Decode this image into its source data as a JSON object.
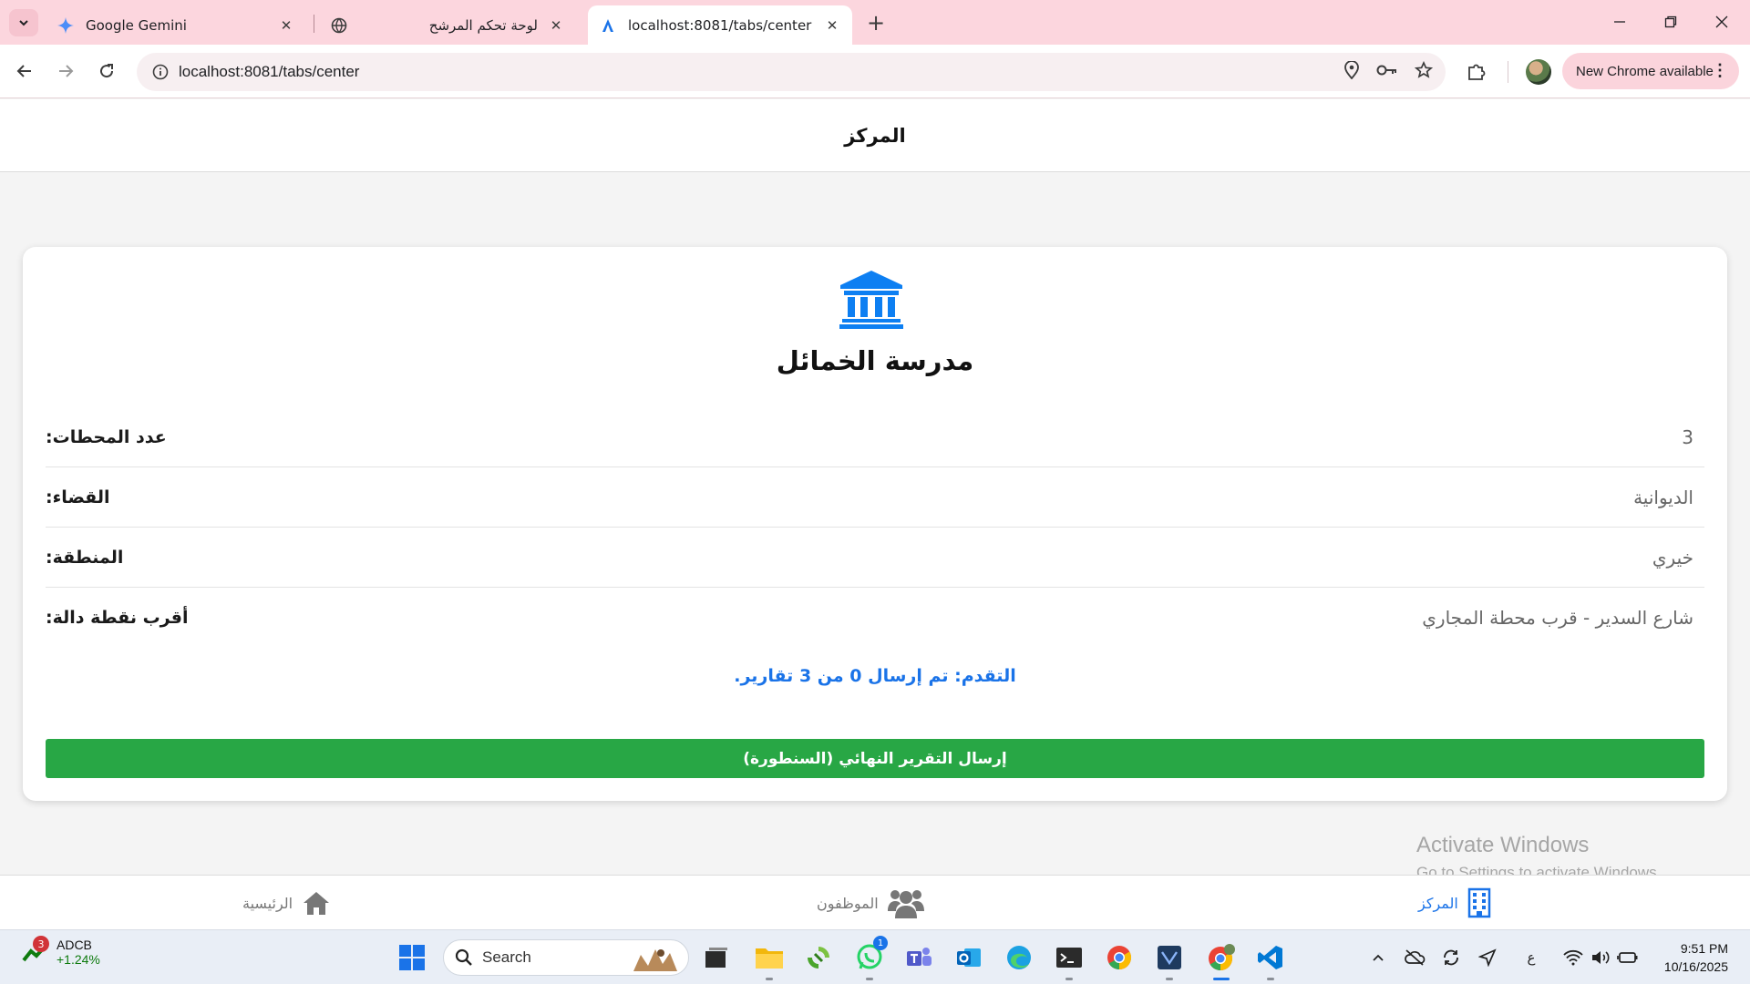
{
  "browser": {
    "tabs": [
      {
        "title": "Google Gemini"
      },
      {
        "title": "لوحة تحكم المرشح"
      },
      {
        "title": "localhost:8081/tabs/center"
      }
    ],
    "url": "localhost:8081/tabs/center",
    "update_label": "New Chrome available"
  },
  "app": {
    "header_title": "المركز",
    "center": {
      "name": "مدرسة الخمائل",
      "fields": [
        {
          "label": "عدد المحطات:",
          "value": "3"
        },
        {
          "label": "القضاء:",
          "value": "الديوانية"
        },
        {
          "label": "المنطقة:",
          "value": "خيري"
        },
        {
          "label": "أقرب نقطة دالة:",
          "value": "شارع السدير - قرب محطة المجاري"
        }
      ]
    },
    "progress_text": "التقدم: تم إرسال 0 من 3 تقارير.",
    "submit_label": "إرسال التقرير النهائي (السنطورة)",
    "bottom_tabs": [
      {
        "label": "الرئيسية",
        "icon": "home-icon"
      },
      {
        "label": "الموظفون",
        "icon": "people-icon"
      },
      {
        "label": "المركز",
        "icon": "building-icon",
        "active": true
      }
    ],
    "accent_color": "#1a73e8",
    "submit_color": "#28a745"
  },
  "watermark": {
    "line1": "Activate Windows",
    "line2": "Go to Settings to activate Windows."
  },
  "taskbar": {
    "stock_name": "ADCB",
    "stock_change": "+1.24%",
    "stock_badge": "3",
    "search_placeholder": "Search",
    "whatsapp_badge": "1",
    "ime_label": "ع",
    "time": "9:51 PM",
    "date": "10/16/2025"
  }
}
